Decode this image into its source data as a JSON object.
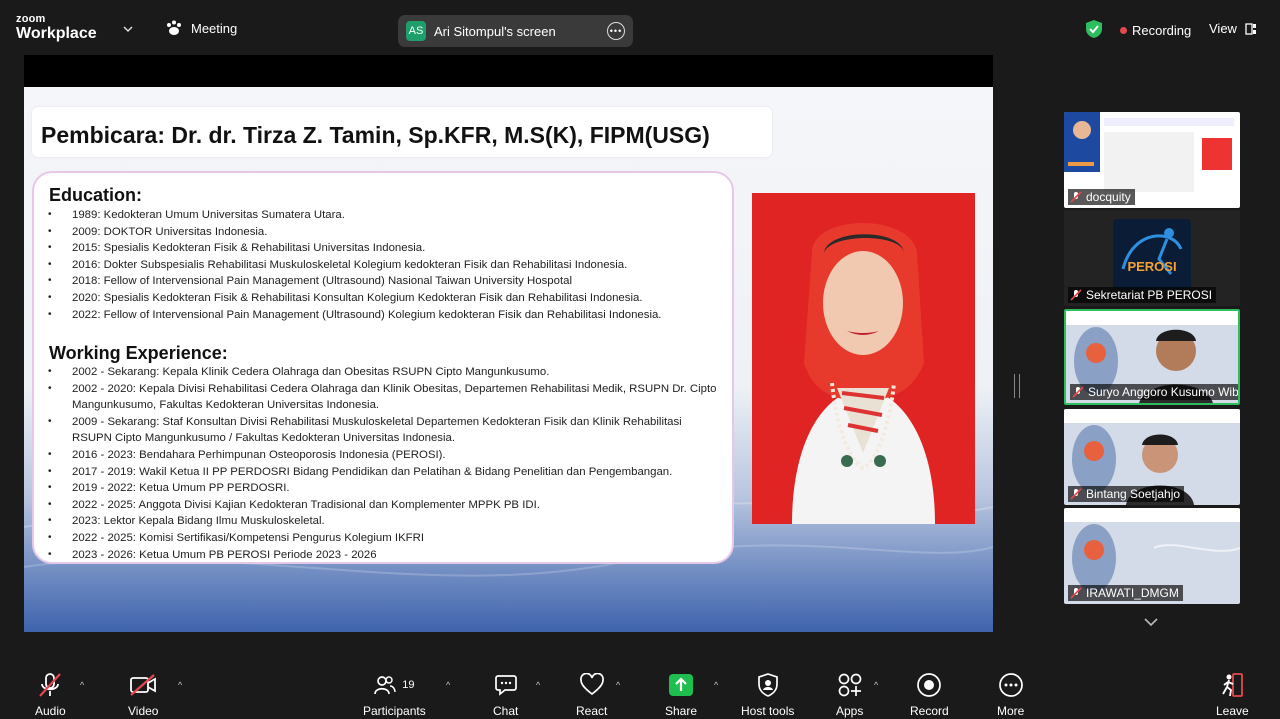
{
  "app": {
    "brand_line1": "zoom",
    "brand_line2": "Workplace",
    "meeting_label": "Meeting"
  },
  "share": {
    "badge": "AS",
    "label": "Ari Sitompul's screen"
  },
  "status": {
    "recording": "Recording",
    "view": "View"
  },
  "slide": {
    "title": "Pembicara: Dr. dr. Tirza Z. Tamin, Sp.KFR, M.S(K), FIPM(USG)",
    "education_heading": "Education:",
    "education": [
      "1989: Kedokteran Umum Universitas Sumatera Utara.",
      "2009: DOKTOR Universitas Indonesia.",
      "2015: Spesialis Kedokteran Fisik & Rehabilitasi Universitas Indonesia.",
      "2016: Dokter Subspesialis Rehabilitasi Muskuloskeletal Kolegium kedokteran Fisik dan Rehabilitasi Indonesia.",
      "2018: Fellow of Intervensional Pain Management (Ultrasound) Nasional Taiwan University Hospotal",
      "2020: Spesialis Kedokteran Fisik & Rehabilitasi Konsultan Kolegium Kedokteran Fisik dan Rehabilitasi Indonesia.",
      "2022: Fellow of Intervensional Pain Management (Ultrasound) Kolegium kedokteran Fisik dan Rehabilitasi Indonesia."
    ],
    "work_heading": "Working Experience:",
    "work": [
      "2002 - Sekarang: Kepala Klinik Cedera Olahraga dan Obesitas RSUPN Cipto Mangunkusumo.",
      "2002 - 2020: Kepala Divisi Rehabilitasi Cedera Olahraga dan Klinik Obesitas, Departemen Rehabilitasi Medik, RSUPN Dr. Cipto Mangunkusumo, Fakultas Kedokteran Universitas Indonesia.",
      "2009 - Sekarang: Staf Konsultan Divisi Rehabilitasi Muskuloskeletal Departemen Kedokteran Fisik dan Klinik Rehabilitasi RSUPN Cipto Mangunkusumo / Fakultas Kedokteran Universitas Indonesia.",
      "2016 - 2023: Bendahara Perhimpunan Osteoporosis Indonesia (PEROSI).",
      "2017 - 2019: Wakil Ketua II PP PERDOSRI Bidang Pendidikan dan Pelatihan & Bidang Penelitian dan Pengembangan.",
      "2019 - 2022: Ketua Umum PP PERDOSRI.",
      "2022 - 2025: Anggota Divisi Kajian Kedokteran Tradisional dan Komplementer MPPK PB IDI.",
      "2023: Lektor Kepala Bidang Ilmu Muskuloskeletal.",
      "2022 - 2025: Komisi Sertifikasi/Kompetensi Pengurus Kolegium IKFRI",
      "2023 - 2026: Ketua Umum PB PEROSI Periode 2023  - 2026"
    ]
  },
  "participants_tiles": [
    {
      "name": "docquity"
    },
    {
      "name": "Sekretariat PB PEROSI",
      "logo_text": "PEROSI"
    },
    {
      "name": "Suryo Anggoro Kusumo Wib..."
    },
    {
      "name": "Bintang Soetjahjo"
    },
    {
      "name": "IRAWATI_DMGM"
    }
  ],
  "toolbar": {
    "audio": "Audio",
    "video": "Video",
    "participants": "Participants",
    "participants_count": "19",
    "chat": "Chat",
    "react": "React",
    "share": "Share",
    "host_tools": "Host tools",
    "apps": "Apps",
    "record": "Record",
    "more": "More",
    "leave": "Leave"
  },
  "colors": {
    "accent_green": "#2dbe60",
    "recording_red": "#e5484d",
    "share_green": "#1e9e6a"
  }
}
